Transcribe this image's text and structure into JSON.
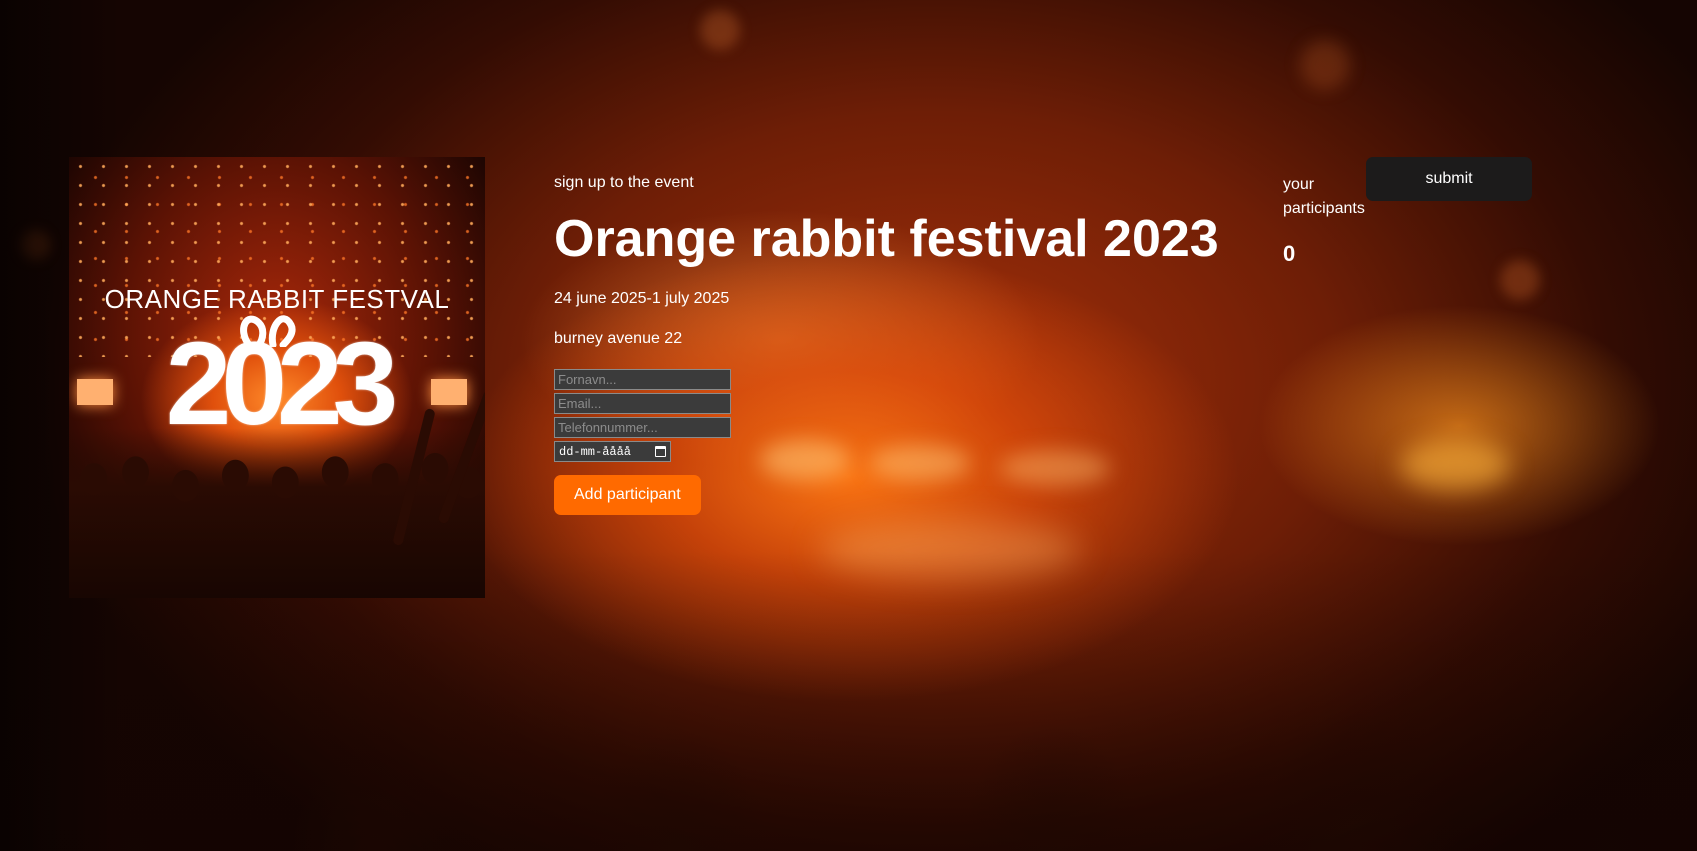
{
  "poster": {
    "title": "ORANGE RABBIT FESTVAL",
    "year": "2023"
  },
  "event": {
    "eyebrow": "sign up to the event",
    "title": "Orange rabbit festival 2023",
    "dates": "24 june 2025-1 july 2025",
    "address": "burney avenue 22"
  },
  "form": {
    "first_name_placeholder": "Fornavn...",
    "email_placeholder": "Email...",
    "phone_placeholder": "Telefonnummer...",
    "date_placeholder": "dd-mm-åååå",
    "add_button_label": "Add participant"
  },
  "participants": {
    "label": "your participants",
    "count": "0"
  },
  "submit_label": "submit",
  "colors": {
    "accent": "#ff6a00",
    "submit_bg": "#1c1b1b",
    "input_bg": "#3b3b3b"
  },
  "icons": {
    "date_picker": "calendar-icon"
  }
}
